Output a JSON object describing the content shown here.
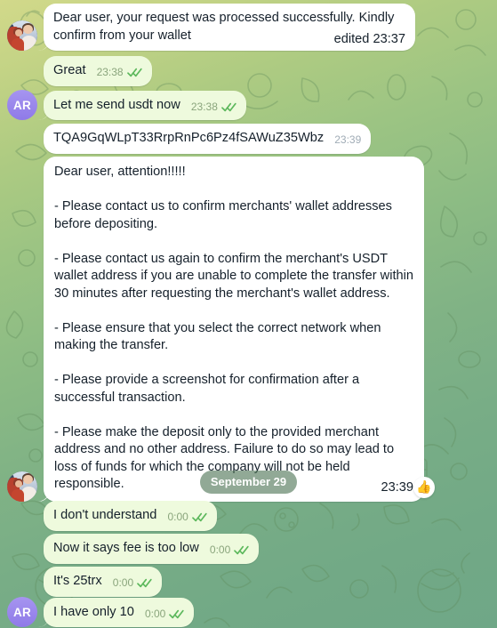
{
  "app": {
    "name": "Telegram",
    "screen": "chat-conversation"
  },
  "theme": {
    "incoming_bubble_color": "#ffffff",
    "outgoing_bubble_color": "#eefadd",
    "text_color": "#15202b",
    "outgoing_meta_color": "#8aa57c",
    "incoming_meta_color": "#a0acb6",
    "tick_color": "#5cb85c",
    "avatar_gradient_from": "#a695f0",
    "avatar_gradient_to": "#8f7ae8",
    "date_pill_bg": "rgba(78,116,86,.62)",
    "background_from": "#d2d98a",
    "background_to": "#6fa787"
  },
  "avatars": {
    "support_alt": "support agents photo",
    "user_initials": "AR"
  },
  "date_divider": {
    "label": "September 29"
  },
  "messages": [
    {
      "id": "m1",
      "direction": "incoming",
      "text": "Dear user, your request was processed successfully. Kindly confirm from your wallet",
      "time": "edited 23:37",
      "ticks": false,
      "avatar": "photo",
      "tail": true
    },
    {
      "id": "m2",
      "direction": "outgoing",
      "text": "Great",
      "time": "23:38",
      "ticks": true,
      "avatar": "none",
      "tail": false
    },
    {
      "id": "m3",
      "direction": "outgoing",
      "text": "Let me send usdt now",
      "time": "23:38",
      "ticks": true,
      "avatar": "initials",
      "tail": true
    },
    {
      "id": "m4",
      "direction": "incoming",
      "text": "TQA9GqWLpT33RrpRnPc6Pz4fSAWuZ35Wbz",
      "time": "23:39",
      "ticks": false,
      "avatar": "none",
      "tail": false
    },
    {
      "id": "m5",
      "direction": "incoming",
      "text": "Dear user, attention!!!!!\n\n- Please contact us to confirm merchants' wallet addresses before depositing.\n\n- Please contact us again to confirm the merchant's USDT wallet address if you are unable to complete the transfer within 30 minutes after requesting the merchant's wallet address.\n\n- Please ensure that you select the correct network when making the transfer.\n\n- Please provide a screenshot for confirmation after a successful transaction.\n\n- Please make the deposit only to the provided merchant address and no other address. Failure to do so may lead to loss of funds for which the company will not be held responsible.",
      "time": "23:39",
      "ticks": false,
      "avatar": "photo",
      "tail": true,
      "reaction": "👍"
    },
    {
      "id": "m6",
      "direction": "outgoing",
      "text": "I don't understand",
      "time": "0:00",
      "ticks": true,
      "avatar": "none",
      "tail": false
    },
    {
      "id": "m7",
      "direction": "outgoing",
      "text": "Now it says fee is too low",
      "time": "0:00",
      "ticks": true,
      "avatar": "none",
      "tail": false
    },
    {
      "id": "m8",
      "direction": "outgoing",
      "text": "It's 25trx",
      "time": "0:00",
      "ticks": true,
      "avatar": "none",
      "tail": false
    },
    {
      "id": "m9",
      "direction": "outgoing",
      "text": "I have only 10",
      "time": "0:00",
      "ticks": true,
      "avatar": "initials",
      "tail": true
    }
  ]
}
